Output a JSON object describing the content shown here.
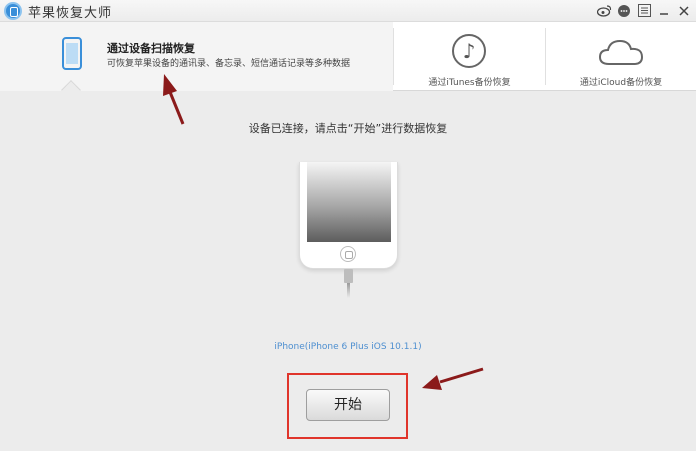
{
  "window": {
    "title": "苹果恢复大师",
    "controls": {
      "weibo": "weibo-icon",
      "feedback": "chat-icon",
      "menu": "menu-icon",
      "minimize": "minimize-icon",
      "close": "close-icon"
    }
  },
  "tabs": [
    {
      "title": "通过设备扫描恢复",
      "description": "可恢复苹果设备的通讯录、备忘录、短信通话记录等多种数据",
      "icon": "phone-icon",
      "active": true
    },
    {
      "label": "通过iTunes备份恢复",
      "icon": "music-note-icon",
      "active": false
    },
    {
      "label": "通过iCloud备份恢复",
      "icon": "cloud-icon",
      "active": false
    }
  ],
  "main": {
    "status": "设备已连接，请点击“开始”进行数据恢复",
    "device_info": "iPhone(iPhone 6 Plus iOS 10.1.1)",
    "start_label": "开始"
  },
  "colors": {
    "accent": "#3a8fd9",
    "device_info_text": "#4e8fd0",
    "annotation": "#e0352b",
    "arrow": "#8b1a1a"
  }
}
